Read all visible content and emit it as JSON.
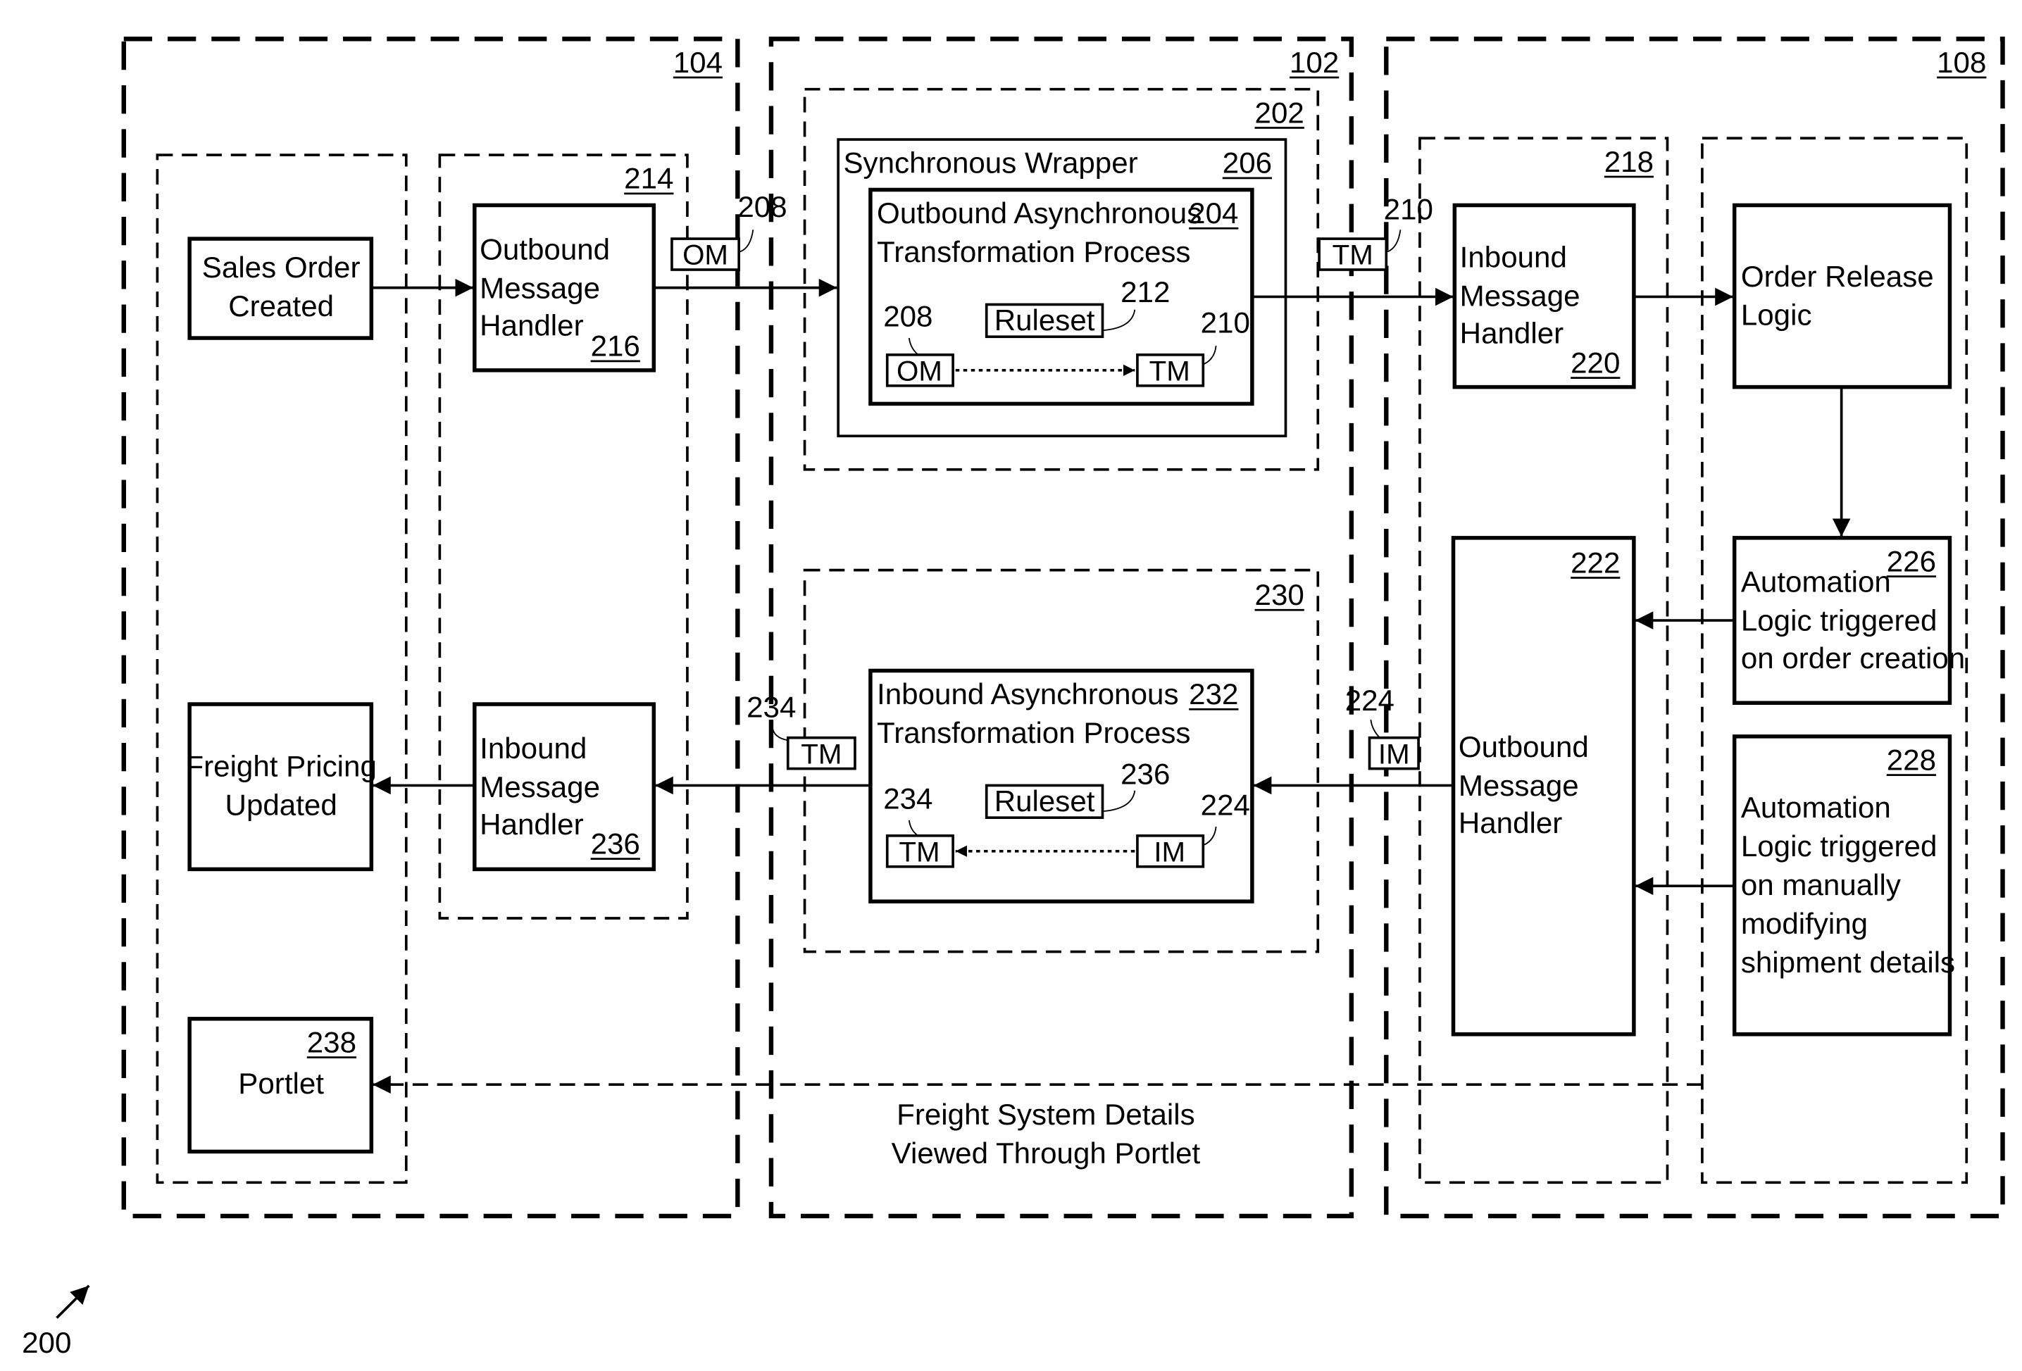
{
  "figure": {
    "figure_number": "200",
    "systems": {
      "left": {
        "ref": "104"
      },
      "middle": {
        "ref": "102"
      },
      "right": {
        "ref": "108"
      }
    },
    "groups": {
      "outbound_handler_group": {
        "ref": "214"
      },
      "sync_group": {
        "ref": "202"
      },
      "inbound_transform_group": {
        "ref": "230"
      },
      "inbound_handler_group": {
        "ref": "218"
      }
    },
    "blocks": {
      "sales_order": {
        "lines": [
          "Sales Order",
          "Created"
        ]
      },
      "outbound_handler_216": {
        "lines": [
          "Outbound",
          "Message",
          "Handler"
        ],
        "ref": "216"
      },
      "sync_wrapper": {
        "label": "Synchronous Wrapper",
        "ref": "206"
      },
      "outbound_async": {
        "lines": [
          "Outbound Asynchronous",
          "Transformation Process"
        ],
        "ref": "204",
        "ruleset": "Ruleset",
        "ruleset_ref": "212",
        "from_tag": "OM",
        "from_ref": "208",
        "to_tag": "TM",
        "to_ref": "210"
      },
      "inbound_handler_220": {
        "lines": [
          "Inbound",
          "Message",
          "Handler"
        ],
        "ref": "220"
      },
      "order_release": {
        "lines": [
          "Order Release",
          "Logic"
        ]
      },
      "auto_226": {
        "lines": [
          "Automation",
          "Logic triggered",
          "on order creation"
        ],
        "ref": "226"
      },
      "auto_228": {
        "lines": [
          "Automation",
          "Logic triggered",
          "on manually",
          "modifying",
          "shipment details"
        ],
        "ref": "228"
      },
      "outbound_handler_222": {
        "lines": [
          "Outbound",
          "Message",
          "Handler"
        ],
        "ref": "222"
      },
      "inbound_async": {
        "lines": [
          "Inbound Asynchronous",
          "Transformation Process"
        ],
        "ref": "232",
        "ruleset": "Ruleset",
        "ruleset_ref": "236",
        "from_tag": "IM",
        "from_ref": "224",
        "to_tag": "TM",
        "to_ref": "234"
      },
      "inbound_handler_236": {
        "lines": [
          "Inbound",
          "Message",
          "Handler"
        ],
        "ref": "236"
      },
      "freight_pricing": {
        "lines": [
          "Freight Pricing",
          "Updated"
        ]
      },
      "portlet": {
        "label": "Portlet",
        "ref": "238"
      }
    },
    "messages": {
      "om": {
        "tag": "OM",
        "ref": "208"
      },
      "tm_out": {
        "tag": "TM",
        "ref": "210"
      },
      "im": {
        "tag": "IM",
        "ref": "224"
      },
      "tm_in": {
        "tag": "TM",
        "ref": "234"
      }
    },
    "portlet_caption": [
      "Freight System Details",
      "Viewed Through Portlet"
    ]
  }
}
